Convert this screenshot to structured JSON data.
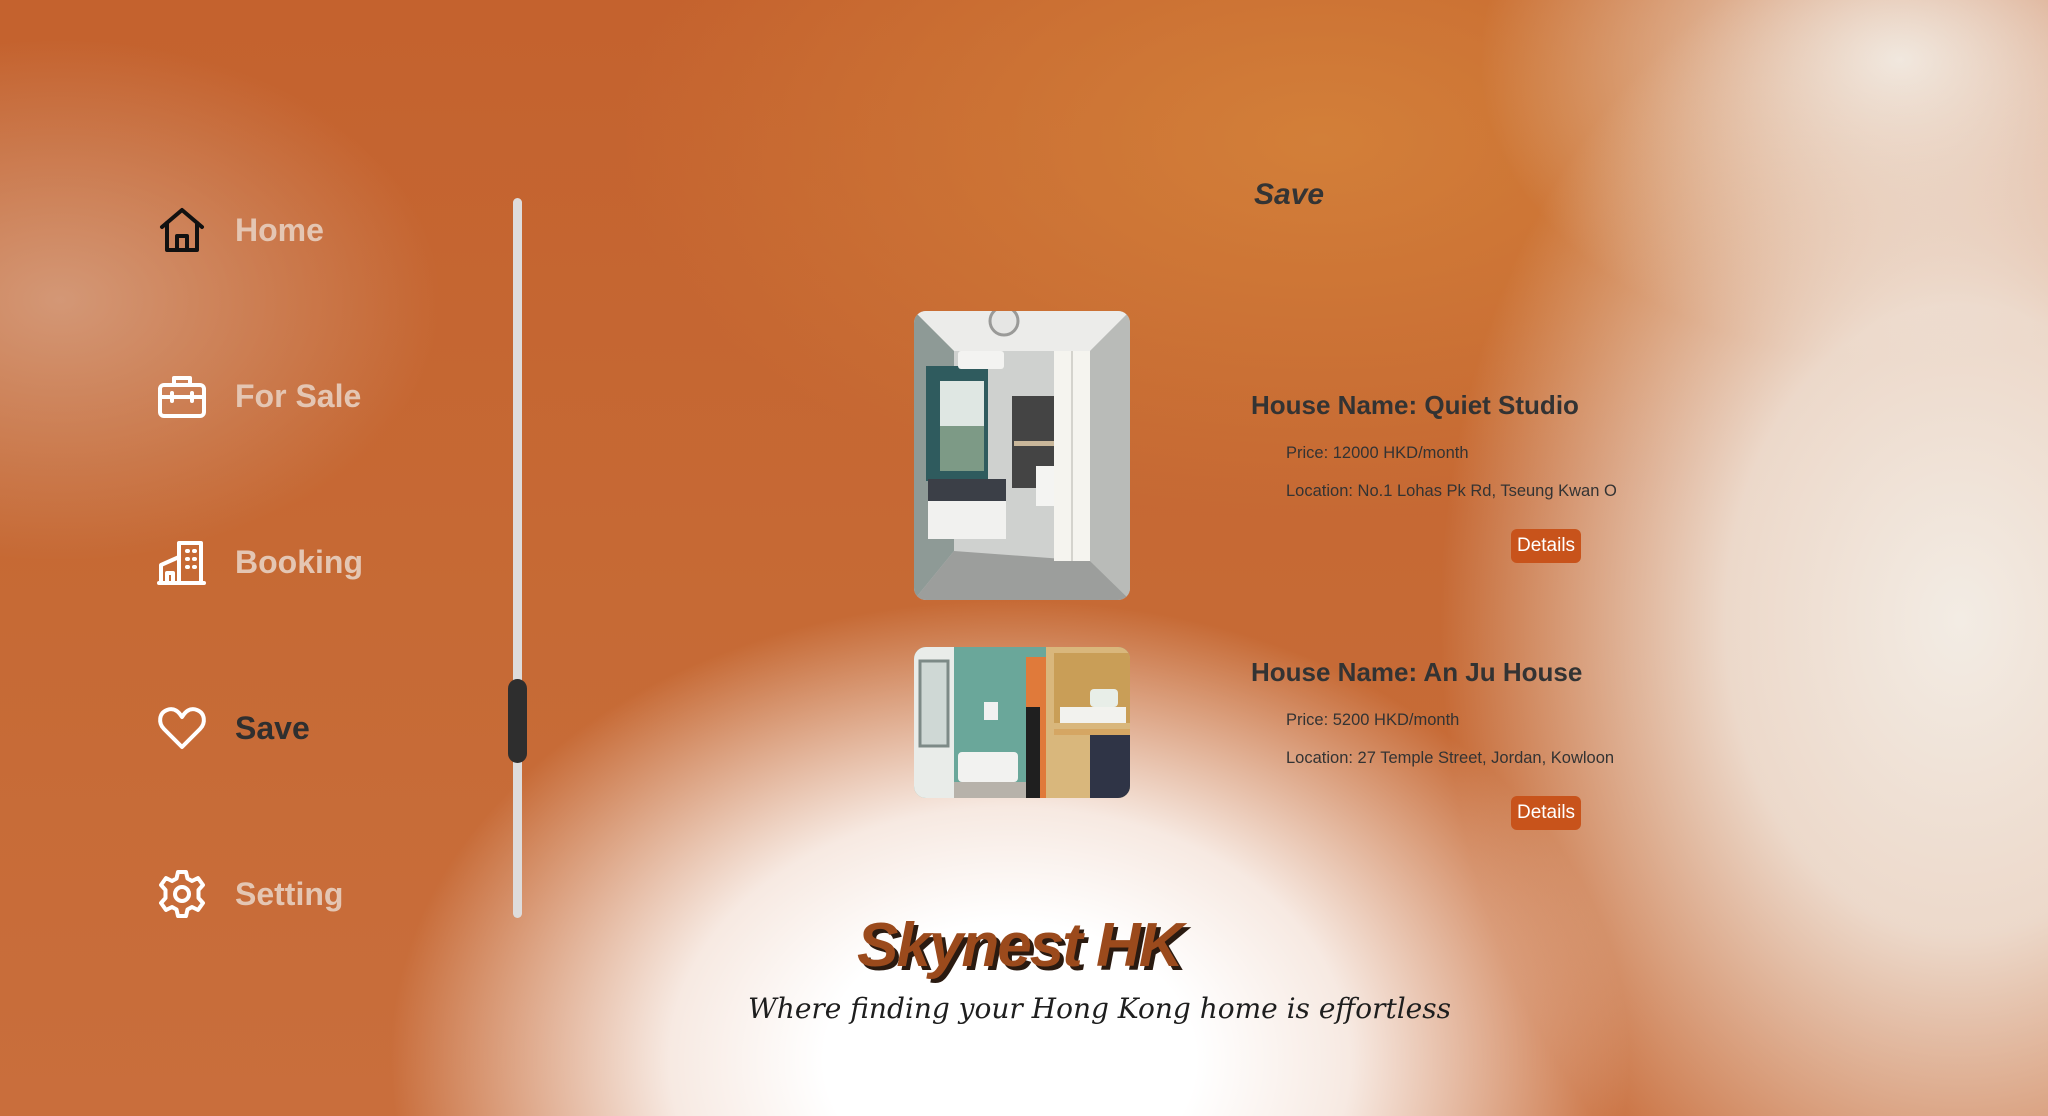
{
  "sidebar": {
    "items": [
      {
        "label": "Home",
        "icon": "home-icon"
      },
      {
        "label": "For Sale",
        "icon": "briefcase-icon"
      },
      {
        "label": "Booking",
        "icon": "building-icon"
      },
      {
        "label": "Save",
        "icon": "heart-icon",
        "active": true
      },
      {
        "label": "Setting",
        "icon": "gear-icon"
      }
    ]
  },
  "main": {
    "title": "Save",
    "listings": [
      {
        "name": "House Name: Quiet Studio",
        "price": "Price: 12000 HKD/month",
        "location": "Location: No.1 Lohas Pk Rd, Tseung Kwan O",
        "button": "Details"
      },
      {
        "name": "House Name: An Ju House",
        "price": "Price: 5200 HKD/month",
        "location": "Location: 27 Temple Street, Jordan, Kowloon",
        "button": "Details"
      }
    ]
  },
  "brand": {
    "name": "Skynest HK",
    "tagline": "Where finding your Hong Kong home is effortless"
  },
  "colors": {
    "accent": "#c8531b",
    "text_dark": "#333333",
    "nav_inactive": "#e4c6b3"
  }
}
